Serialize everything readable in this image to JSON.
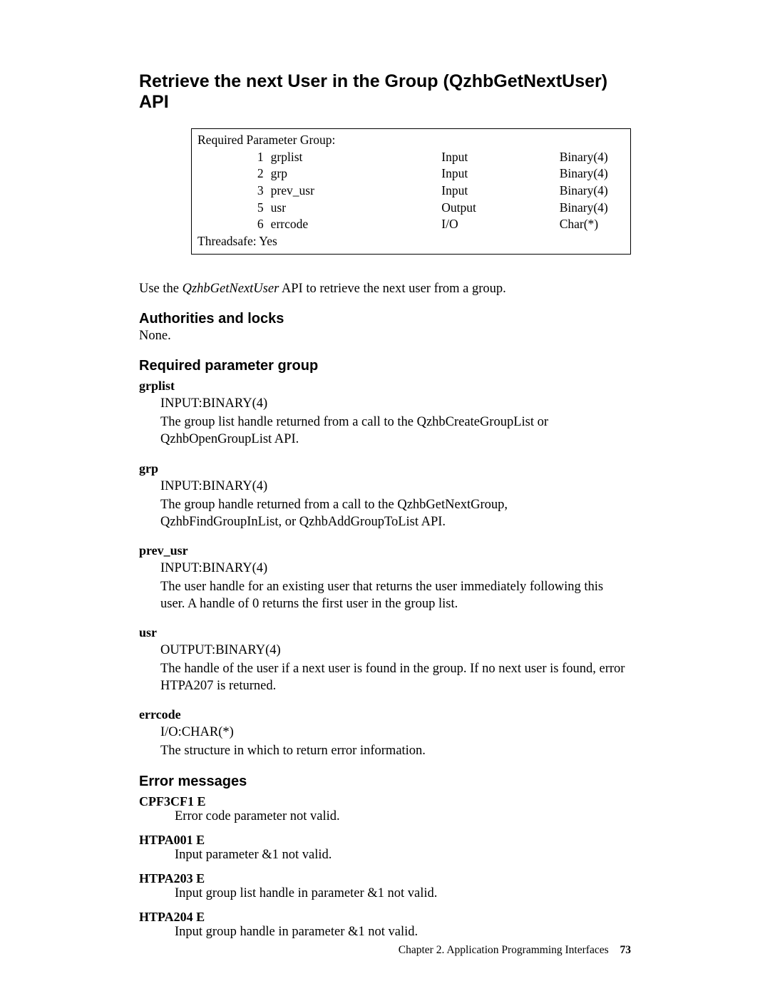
{
  "title": "Retrieve the next User in the Group (QzhbGetNextUser) API",
  "param_box": {
    "header": "Required Parameter Group:",
    "rows": [
      {
        "num": "1",
        "name": "grplist",
        "io": "Input",
        "type": "Binary(4)"
      },
      {
        "num": "2",
        "name": "grp",
        "io": "Input",
        "type": "Binary(4)"
      },
      {
        "num": "3",
        "name": "prev_usr",
        "io": "Input",
        "type": "Binary(4)"
      },
      {
        "num": "5",
        "name": "usr",
        "io": "Output",
        "type": "Binary(4)"
      },
      {
        "num": "6",
        "name": "errcode",
        "io": "I/O",
        "type": "Char(*)"
      }
    ],
    "threadsafe": "Threadsafe: Yes"
  },
  "intro_pre": "Use the ",
  "intro_em": "QzhbGetNextUser",
  "intro_post": " API to retrieve the next user from a group.",
  "sections": {
    "auth": "Authorities and locks",
    "auth_body": "None.",
    "req": "Required parameter group",
    "err": "Error messages"
  },
  "params": [
    {
      "term": "grplist",
      "type": "INPUT:BINARY(4)",
      "desc": "The group list handle returned from a call to the QzhbCreateGroupList or QzhbOpenGroupList API."
    },
    {
      "term": "grp",
      "type": "INPUT:BINARY(4)",
      "desc": "The group handle returned from a call to the QzhbGetNextGroup, QzhbFindGroupInList, or QzhbAddGroupToList API."
    },
    {
      "term": "prev_usr",
      "type": "INPUT:BINARY(4)",
      "desc": "The user handle for an existing user that returns the user immediately following this user. A handle of 0 returns the first user in the group list."
    },
    {
      "term": "usr",
      "type": "OUTPUT:BINARY(4)",
      "desc": "The handle of the user if a next user is found in the group. If no next user is found, error HTPA207 is returned."
    },
    {
      "term": "errcode",
      "type": "I/O:CHAR(*)",
      "desc": "The structure in which to return error information."
    }
  ],
  "errors": [
    {
      "code": "CPF3CF1 E",
      "msg": "Error code parameter not valid."
    },
    {
      "code": "HTPA001 E",
      "msg": "Input parameter &1 not valid."
    },
    {
      "code": "HTPA203 E",
      "msg": "Input group list handle in parameter &1 not valid."
    },
    {
      "code": "HTPA204 E",
      "msg": "Input group handle in parameter &1 not valid."
    }
  ],
  "footer": {
    "chapter": "Chapter 2. Application Programming Interfaces",
    "page": "73"
  }
}
